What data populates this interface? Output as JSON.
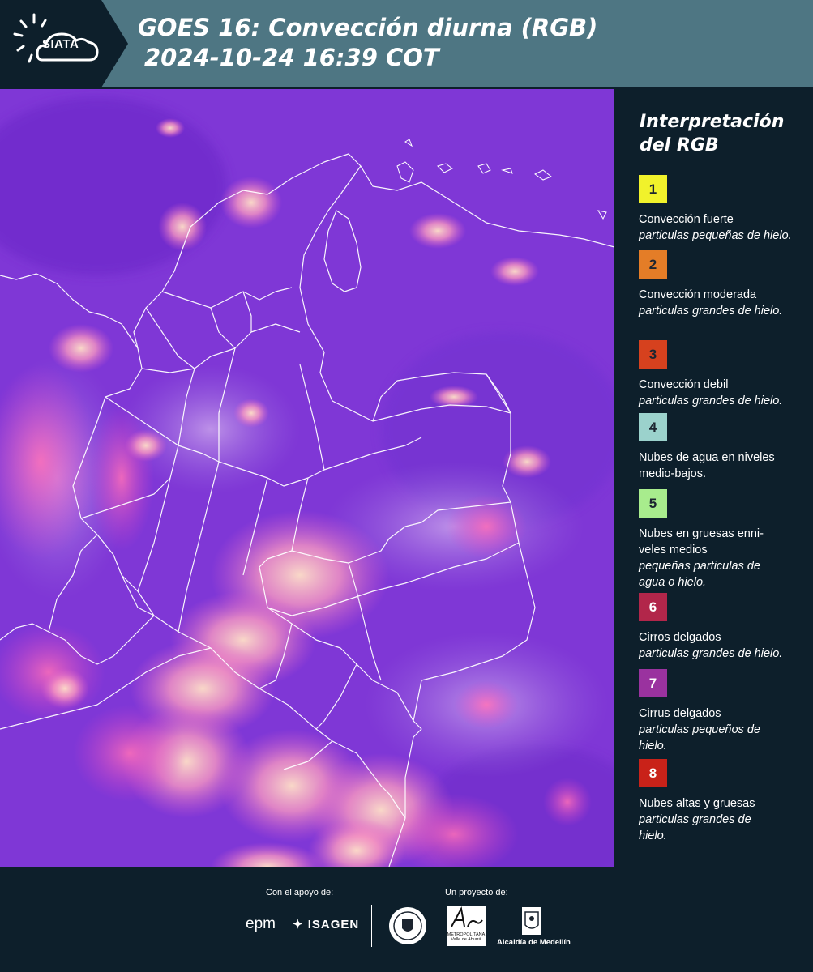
{
  "header": {
    "logo_text": "SIATA",
    "title_line1": "GOES 16: Convección diurna (RGB)",
    "title_line2": "2024-10-24 16:39 COT"
  },
  "legend": {
    "title_line1": "Interpretación",
    "title_line2": "del RGB",
    "items": [
      {
        "number": "1",
        "color": "#f1f22b",
        "label": "Convección fuerte",
        "sub": "particulas pequeñas de hielo."
      },
      {
        "number": "2",
        "color": "#e47d27",
        "label": "Convección moderada",
        "sub": "particulas grandes de hielo."
      },
      {
        "number": "3",
        "color": "#d6411e",
        "label": "Convección debil",
        "sub": "particulas grandes de hielo."
      },
      {
        "number": "4",
        "color": "#9bd2cc",
        "label": "Nubes de agua en niveles medio-bajos.",
        "sub": ""
      },
      {
        "number": "5",
        "color": "#a8ec8d",
        "label": "Nubes en gruesas enni-veles medios",
        "sub": "pequeñas particulas de agua o hielo."
      },
      {
        "number": "6",
        "color": "#b2264a",
        "label": "Cirros delgados",
        "sub": "particulas grandes de hielo."
      },
      {
        "number": "7",
        "color": "#9a329f",
        "label": "Cirrus delgados",
        "sub": "particulas pequeños de hielo."
      },
      {
        "number": "8",
        "color": "#c92219",
        "label": "Nubes altas y gruesas",
        "sub": "particulas grandes de hielo."
      }
    ]
  },
  "footer": {
    "support_label": "Con el apoyo de:",
    "project_label": "Un proyecto de:",
    "epm": "epm",
    "isagen": "ISAGEN",
    "area_label": "METROPOLITANA Valle de Aburrá",
    "alcaldia": "Alcaldía de Medellín"
  },
  "colors": {
    "header_bg": "#4e7683",
    "panel_bg": "#0d1f2b",
    "map_base": "#7f37d6"
  }
}
